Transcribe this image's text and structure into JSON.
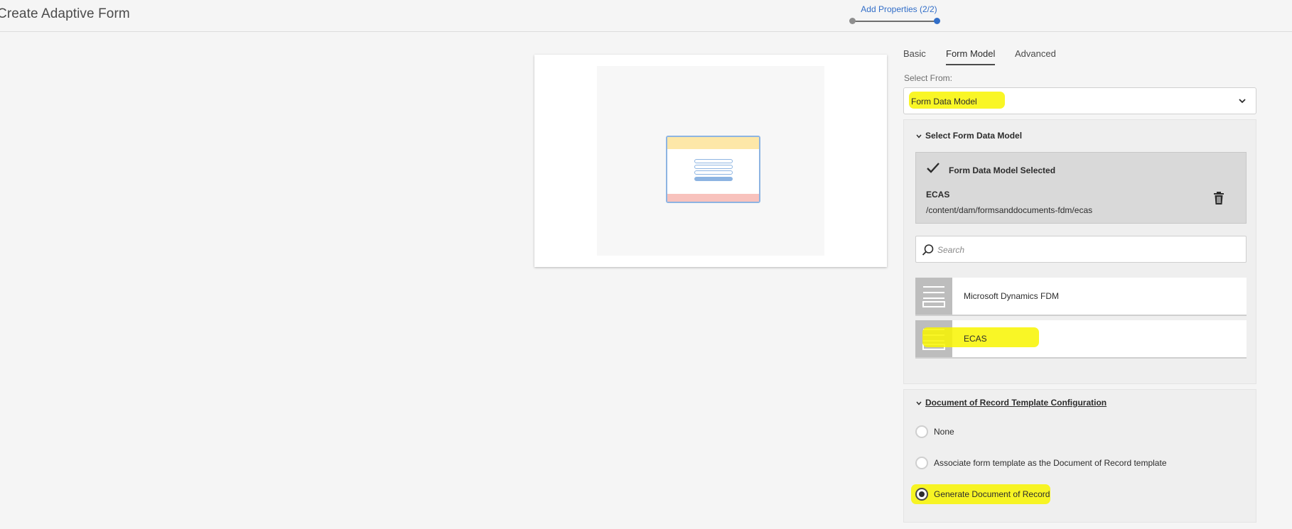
{
  "header": {
    "title": "Create Adaptive Form",
    "wizard_step_label": "Add Properties (2/2)"
  },
  "tabs": [
    {
      "label": "Basic",
      "active": false
    },
    {
      "label": "Form Model",
      "active": true
    },
    {
      "label": "Advanced",
      "active": false
    }
  ],
  "select_from": {
    "label": "Select From:",
    "value": "Form Data Model"
  },
  "form_data_model_section": {
    "header": "Select Form Data Model",
    "selected": {
      "status": "Form Data Model Selected",
      "name": "ECAS",
      "path": "/content/dam/formsanddocuments-fdm/ecas"
    },
    "search_placeholder": "Search",
    "items": [
      {
        "label": "Microsoft Dynamics FDM"
      },
      {
        "label": "ECAS"
      }
    ]
  },
  "document_of_record_section": {
    "header": "Document of Record Template Configuration",
    "options": [
      {
        "label": "None",
        "checked": false
      },
      {
        "label": "Associate form template as the Document of Record template",
        "checked": false
      },
      {
        "label": "Generate Document of Record",
        "checked": true
      }
    ]
  },
  "colors": {
    "accent": "#326ec8",
    "highlight": "#f8f400"
  }
}
